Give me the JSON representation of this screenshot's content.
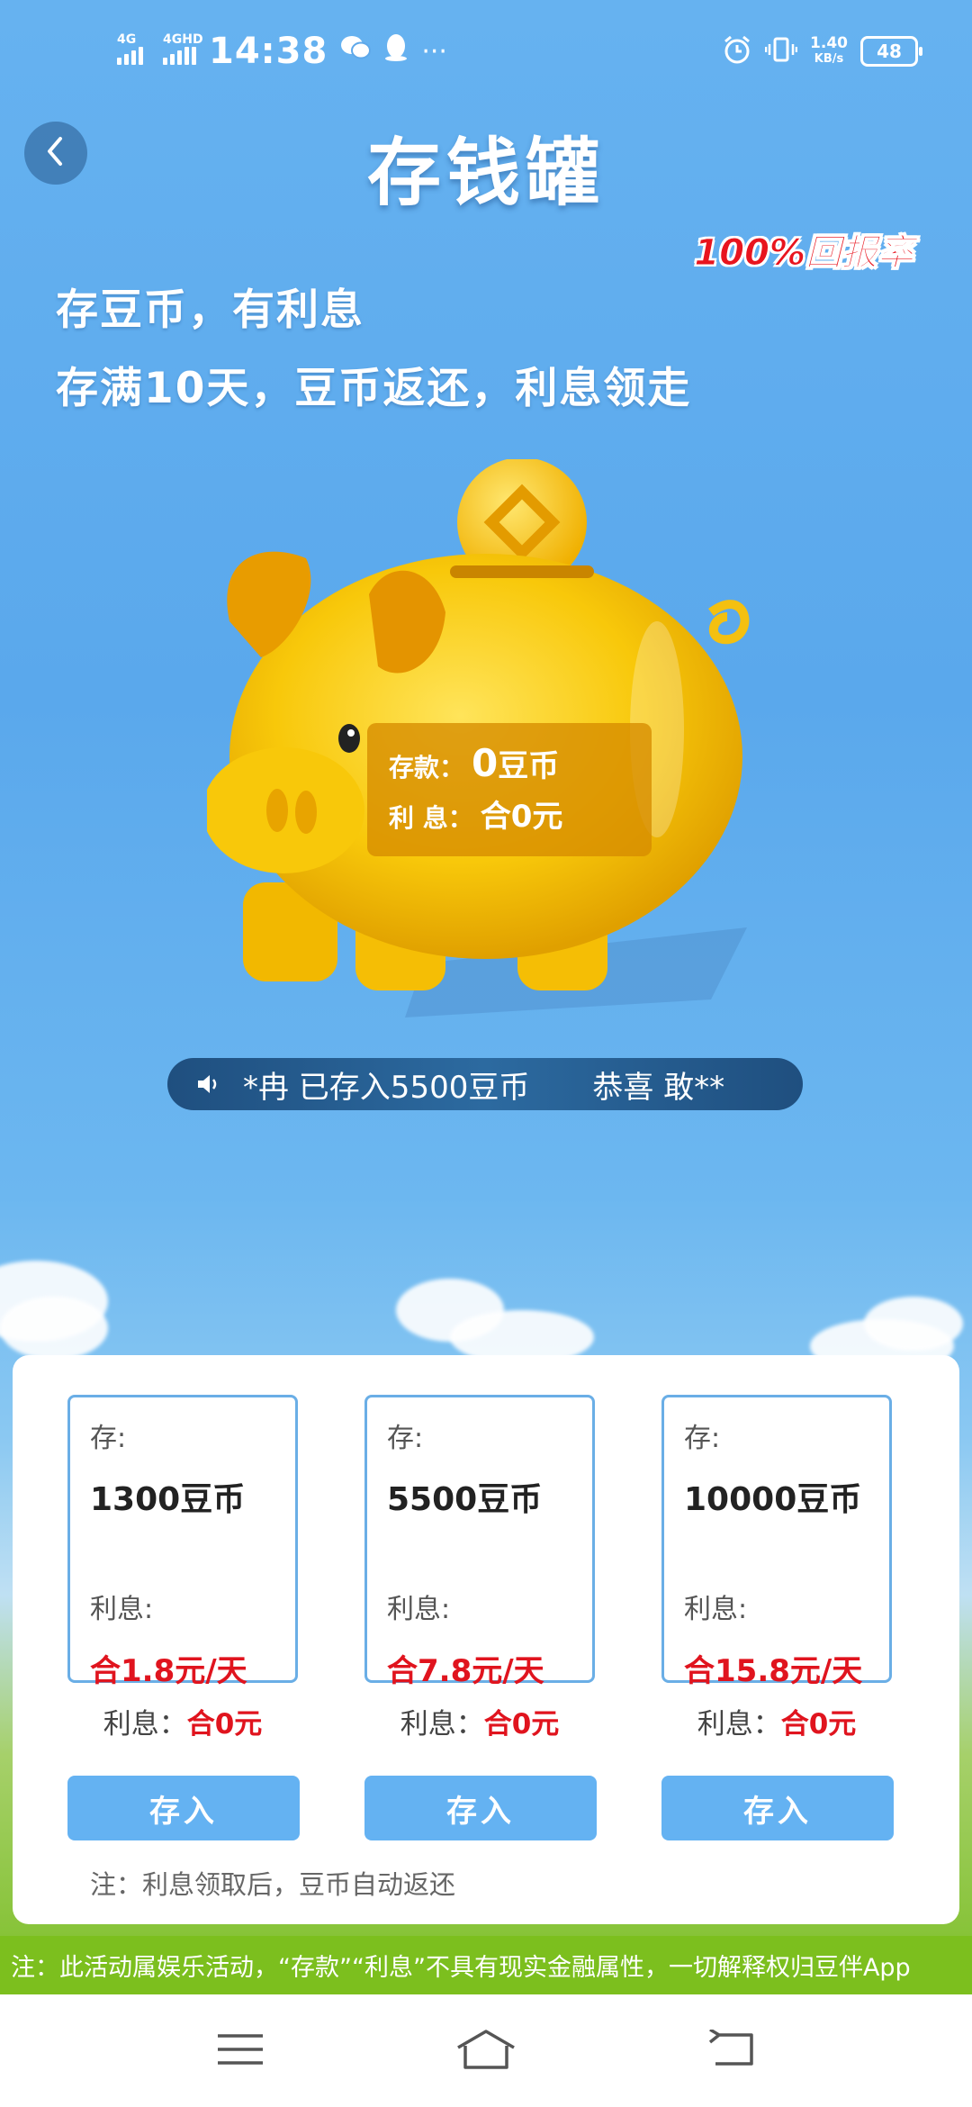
{
  "status_bar": {
    "signal1": "4G",
    "signal2": "4GHD",
    "time": "14:38",
    "more": "···",
    "net_speed_value": "1.40",
    "net_speed_unit": "KB/s",
    "battery": "48"
  },
  "header": {
    "title": "存钱罐",
    "rate_badge": "100%回报率"
  },
  "intro": {
    "line1": "存豆币，有利息",
    "line2": "存满10天，豆币返还，利息领走"
  },
  "piggy": {
    "deposit_label": "存款：",
    "deposit_amount": "0",
    "deposit_unit": "豆币",
    "interest_label": "利 息：",
    "interest_value": "合0元"
  },
  "ticker": {
    "message1": "*冉  已存入5500豆币",
    "message2": "恭喜  敢**"
  },
  "plans": [
    {
      "deposit_label": "存:",
      "amount": "1300豆币",
      "interest_label": "利息:",
      "rate": "合1.8元/天",
      "earned_label": "利息：",
      "earned_value": "合0元",
      "button": "存入"
    },
    {
      "deposit_label": "存:",
      "amount": "5500豆币",
      "interest_label": "利息:",
      "rate": "合7.8元/天",
      "earned_label": "利息：",
      "earned_value": "合0元",
      "button": "存入"
    },
    {
      "deposit_label": "存:",
      "amount": "10000豆币",
      "interest_label": "利息:",
      "rate": "合15.8元/天",
      "earned_label": "利息：",
      "earned_value": "合0元",
      "button": "存入"
    }
  ],
  "card_note": "注：利息领取后，豆币自动返还",
  "disclaimer": "注：此活动属娱乐活动，“存款”“利息”不具有现实金融属性，一切解释权归豆伴App",
  "icons": {
    "back": "chevron-left-icon",
    "speaker": "speaker-icon",
    "nav_menu": "menu-icon",
    "nav_home": "home-icon",
    "nav_back": "back-icon"
  },
  "colors": {
    "accent_blue": "#64b2f2",
    "interest_red": "#e0141e",
    "disclaimer_green": "#7cbf1e"
  }
}
